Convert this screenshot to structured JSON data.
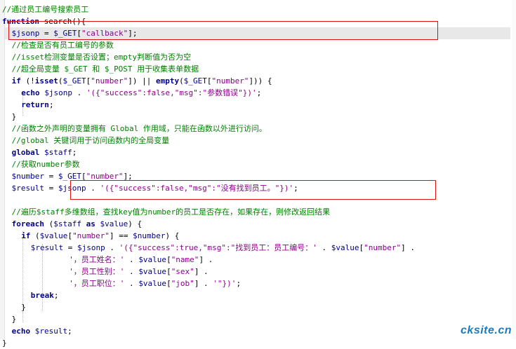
{
  "colors": {
    "comment": "#008000",
    "keyword": "#00008b",
    "variable": "#00008b",
    "string": "#8b008b",
    "highlight_box": "#e01010",
    "watermark": "#1d7bbd"
  },
  "code_lines": [
    {
      "indent": 0,
      "tokens": [
        [
          "comment",
          "//通过员工编号搜索员工"
        ]
      ]
    },
    {
      "indent": 0,
      "tokens": [
        [
          "kw",
          "function"
        ],
        [
          "plain",
          " search(){"
        ]
      ]
    },
    {
      "indent": 2,
      "highlighted": true,
      "tokens": [
        [
          "var",
          "$jsonp"
        ],
        [
          "plain",
          " = "
        ],
        [
          "var",
          "$_GET"
        ],
        [
          "plain",
          "["
        ],
        [
          "str",
          "\"callback\""
        ],
        [
          "plain",
          "];"
        ]
      ]
    },
    {
      "indent": 2,
      "tokens": [
        [
          "comment",
          "//检查是否有员工编号的参数"
        ]
      ]
    },
    {
      "indent": 2,
      "tokens": [
        [
          "comment",
          "//isset检测变量是否设置；empty判断值为否为空"
        ]
      ]
    },
    {
      "indent": 2,
      "tokens": [
        [
          "comment",
          "//超全局变量 $_GET 和 $_POST 用于收集表单数据"
        ]
      ]
    },
    {
      "indent": 2,
      "tokens": [
        [
          "kw",
          "if"
        ],
        [
          "plain",
          " (!"
        ],
        [
          "kw",
          "isset"
        ],
        [
          "plain",
          "("
        ],
        [
          "var",
          "$_GET"
        ],
        [
          "plain",
          "["
        ],
        [
          "str",
          "\"number\""
        ],
        [
          "plain",
          "]) || "
        ],
        [
          "kw",
          "empty"
        ],
        [
          "plain",
          "("
        ],
        [
          "var",
          "$_GET"
        ],
        [
          "plain",
          "["
        ],
        [
          "str",
          "\"number\""
        ],
        [
          "plain",
          "])) {"
        ]
      ]
    },
    {
      "indent": 4,
      "tokens": [
        [
          "kw",
          "echo"
        ],
        [
          "plain",
          " "
        ],
        [
          "var",
          "$jsonp"
        ],
        [
          "plain",
          " . "
        ],
        [
          "str",
          "'({\"success\":false,\"msg\":\"参数错误\"})'"
        ],
        [
          "plain",
          ";"
        ]
      ]
    },
    {
      "indent": 4,
      "tokens": [
        [
          "kw",
          "return"
        ],
        [
          "plain",
          ";"
        ]
      ]
    },
    {
      "indent": 2,
      "tokens": [
        [
          "plain",
          "}"
        ]
      ]
    },
    {
      "indent": 2,
      "tokens": [
        [
          "comment",
          "//函数之外声明的变量拥有 Global 作用域，只能在函数以外进行访问。"
        ]
      ]
    },
    {
      "indent": 2,
      "tokens": [
        [
          "comment",
          "//global 关键词用于访问函数内的全局变量"
        ]
      ]
    },
    {
      "indent": 2,
      "tokens": [
        [
          "kw",
          "global"
        ],
        [
          "plain",
          " "
        ],
        [
          "var",
          "$staff"
        ],
        [
          "plain",
          ";"
        ]
      ]
    },
    {
      "indent": 2,
      "tokens": [
        [
          "comment",
          "//获取number参数"
        ]
      ]
    },
    {
      "indent": 2,
      "tokens": [
        [
          "var",
          "$number"
        ],
        [
          "plain",
          " = "
        ],
        [
          "var",
          "$_GET"
        ],
        [
          "plain",
          "["
        ],
        [
          "str",
          "\"number\""
        ],
        [
          "plain",
          "];"
        ]
      ]
    },
    {
      "indent": 2,
      "tokens": [
        [
          "var",
          "$result"
        ],
        [
          "plain",
          " = "
        ],
        [
          "var",
          "$jsonp"
        ],
        [
          "plain",
          " . "
        ],
        [
          "str",
          "'({\"success\":false,\"msg\":\"没有找到员工。\"})'"
        ],
        [
          "plain",
          ";"
        ]
      ]
    },
    {
      "indent": 0,
      "tokens": []
    },
    {
      "indent": 2,
      "tokens": [
        [
          "comment",
          "//遍历$staff多维数组，查找key值为number的员工是否存在，如果存在，则修改返回结果"
        ]
      ]
    },
    {
      "indent": 2,
      "tokens": [
        [
          "kw",
          "foreach"
        ],
        [
          "plain",
          " ("
        ],
        [
          "var",
          "$staff"
        ],
        [
          "plain",
          " "
        ],
        [
          "kw",
          "as"
        ],
        [
          "plain",
          " "
        ],
        [
          "var",
          "$value"
        ],
        [
          "plain",
          ") {"
        ]
      ]
    },
    {
      "indent": 4,
      "tokens": [
        [
          "kw",
          "if"
        ],
        [
          "plain",
          " ("
        ],
        [
          "var",
          "$value"
        ],
        [
          "plain",
          "["
        ],
        [
          "str",
          "\"number\""
        ],
        [
          "plain",
          "] == "
        ],
        [
          "var",
          "$number"
        ],
        [
          "plain",
          ") {"
        ]
      ]
    },
    {
      "indent": 6,
      "tokens": [
        [
          "var",
          "$result"
        ],
        [
          "plain",
          " = "
        ],
        [
          "var",
          "$jsonp"
        ],
        [
          "plain",
          " . "
        ],
        [
          "str",
          "'({\"success\":true,\"msg\":\"找到员工：员工编号：'"
        ],
        [
          "plain",
          " . "
        ],
        [
          "var",
          "$value"
        ],
        [
          "plain",
          "["
        ],
        [
          "str",
          "\"number\""
        ],
        [
          "plain",
          "] ."
        ]
      ]
    },
    {
      "indent": 14,
      "tokens": [
        [
          "str",
          "'，员工姓名：'"
        ],
        [
          "plain",
          " . "
        ],
        [
          "var",
          "$value"
        ],
        [
          "plain",
          "["
        ],
        [
          "str",
          "\"name\""
        ],
        [
          "plain",
          "] ."
        ]
      ]
    },
    {
      "indent": 14,
      "tokens": [
        [
          "str",
          "'，员工性别：'"
        ],
        [
          "plain",
          " . "
        ],
        [
          "var",
          "$value"
        ],
        [
          "plain",
          "["
        ],
        [
          "str",
          "\"sex\""
        ],
        [
          "plain",
          "] ."
        ]
      ]
    },
    {
      "indent": 14,
      "tokens": [
        [
          "str",
          "'，员工职位：'"
        ],
        [
          "plain",
          " . "
        ],
        [
          "var",
          "$value"
        ],
        [
          "plain",
          "["
        ],
        [
          "str",
          "\"job\""
        ],
        [
          "plain",
          "] . "
        ],
        [
          "str",
          "'\"})'"
        ],
        [
          "plain",
          ";"
        ]
      ]
    },
    {
      "indent": 6,
      "tokens": [
        [
          "kw",
          "break"
        ],
        [
          "plain",
          ";"
        ]
      ]
    },
    {
      "indent": 4,
      "tokens": [
        [
          "plain",
          "}"
        ]
      ]
    },
    {
      "indent": 2,
      "tokens": [
        [
          "plain",
          "}"
        ]
      ]
    },
    {
      "indent": 2,
      "tokens": [
        [
          "kw",
          "echo"
        ],
        [
          "plain",
          " "
        ],
        [
          "var",
          "$result"
        ],
        [
          "plain",
          ";"
        ]
      ]
    },
    {
      "indent": 0,
      "tokens": [
        [
          "plain",
          "}"
        ]
      ]
    }
  ],
  "watermark": "cksite.cn"
}
